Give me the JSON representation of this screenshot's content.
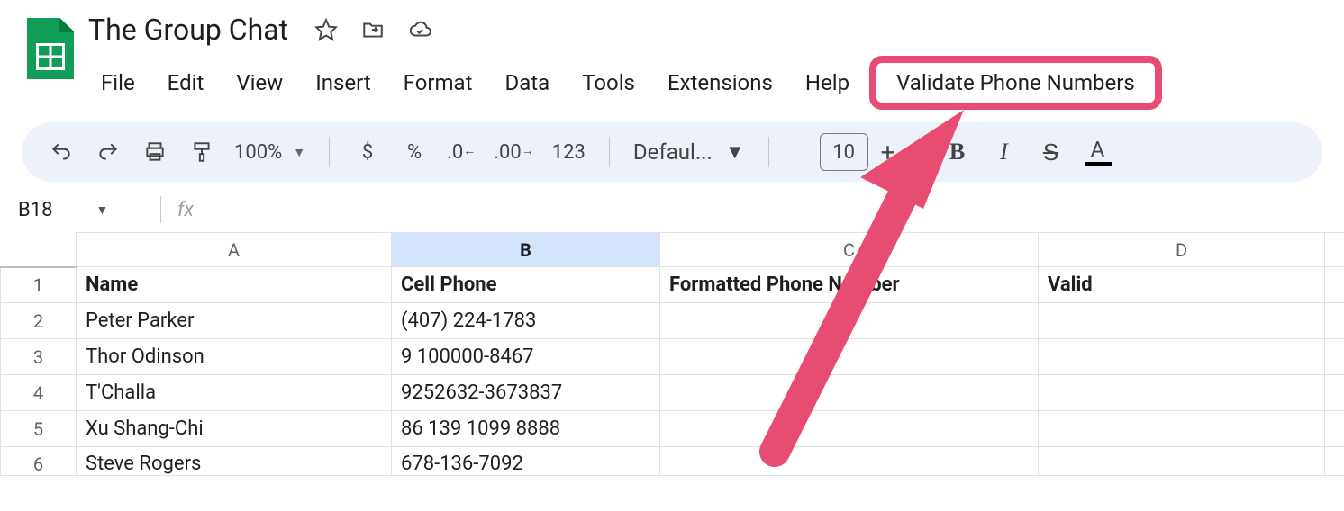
{
  "doc": {
    "title": "The Group Chat"
  },
  "menus": {
    "file": "File",
    "edit": "Edit",
    "view": "View",
    "insert": "Insert",
    "format": "Format",
    "data": "Data",
    "tools": "Tools",
    "extensions": "Extensions",
    "help": "Help",
    "custom": "Validate Phone Numbers"
  },
  "toolbar": {
    "zoom": "100%",
    "currency": "$",
    "percent": "%",
    "dec_dec": ".0",
    "dec_inc": ".00",
    "numfmt": "123",
    "font": "Defaul...",
    "font_size_minus": "−",
    "font_size": "10",
    "font_size_plus": "+",
    "bold": "B",
    "italic": "I",
    "strike": "S",
    "textcolor": "A"
  },
  "namebox": {
    "ref": "B18",
    "fx": "fx"
  },
  "columns": {
    "A": "A",
    "B": "B",
    "C": "C",
    "D": "D"
  },
  "rows": [
    "1",
    "2",
    "3",
    "4",
    "5",
    "6"
  ],
  "headers": {
    "name": "Name",
    "cell": "Cell Phone",
    "formatted": "Formatted Phone Number",
    "valid": "Valid"
  },
  "data_rows": [
    {
      "name": "Peter Parker",
      "cell": "(407) 224-1783"
    },
    {
      "name": "Thor Odinson",
      "cell": "9 100000-8467"
    },
    {
      "name": "T'Challa",
      "cell": "9252632-3673837"
    },
    {
      "name": "Xu Shang-Chi",
      "cell": "86 139 1099 8888"
    },
    {
      "name": "Steve Rogers",
      "cell": "678-136-7092"
    }
  ]
}
